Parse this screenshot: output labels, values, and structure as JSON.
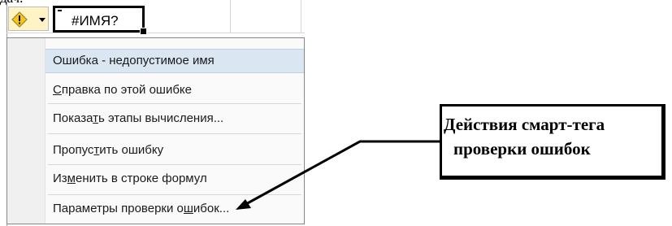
{
  "top_fragment": "дач.",
  "cell": {
    "value": "#ИМЯ?"
  },
  "smart_tag": {
    "icon": "warning-diamond-icon",
    "dropdown_icon": "dropdown-arrow-icon"
  },
  "menu": {
    "header": "Ошибка - недопустимое имя",
    "items": [
      {
        "pre": "",
        "u": "С",
        "post": "правка по этой ошибке"
      },
      {
        "pre": "Показа",
        "u": "т",
        "post": "ь этапы вычисления..."
      },
      {
        "pre": "Пропус",
        "u": "т",
        "post": "ить ошибку"
      },
      {
        "pre": "Из",
        "u": "м",
        "post": "енить в строке формул"
      },
      {
        "pre": "Параметры проверки о",
        "u": "ш",
        "post": "ибок..."
      }
    ]
  },
  "callout": {
    "line1": "Действия смарт-тега",
    "line2": "проверки ошибок"
  }
}
